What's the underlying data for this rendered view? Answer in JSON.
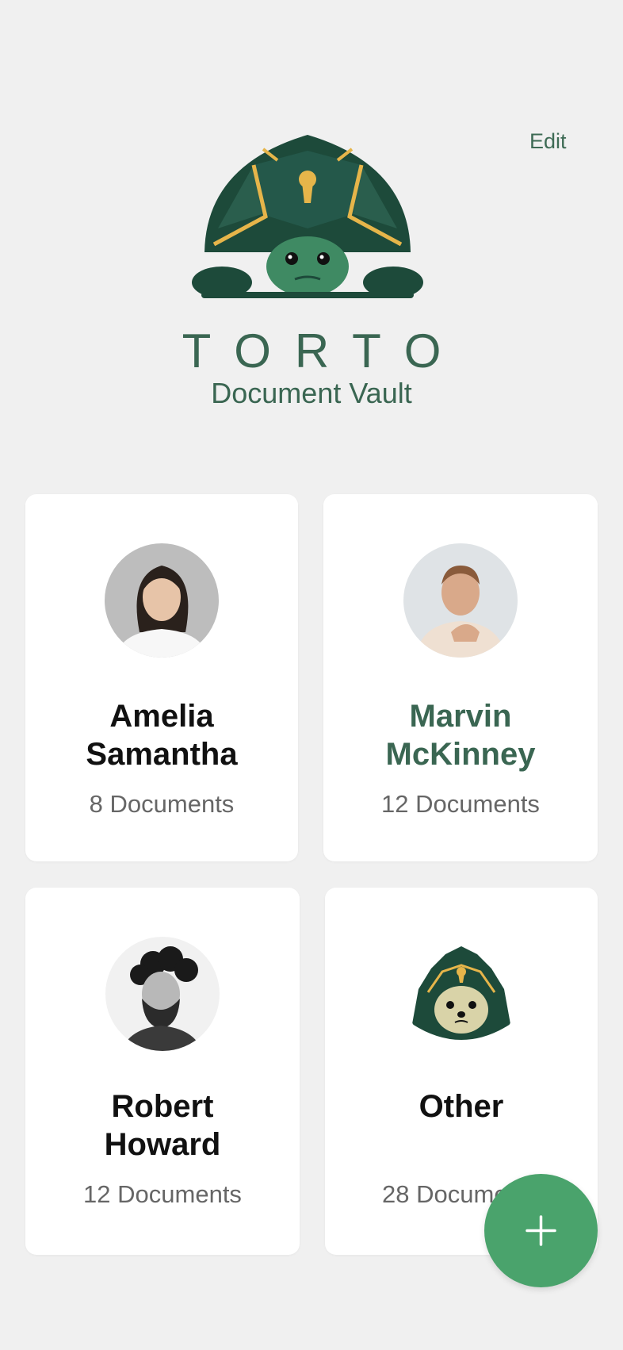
{
  "header": {
    "edit_label": "Edit",
    "brand_title": "TORTO",
    "brand_subtitle": "Document Vault"
  },
  "profiles": [
    {
      "name": "Amelia Samantha",
      "name_line1": "Amelia",
      "name_line2": "Samantha",
      "count": "8 Documents"
    },
    {
      "name": "Marvin McKinney",
      "name_line1": "Marvin",
      "name_line2": "McKinney",
      "count": "12 Documents"
    },
    {
      "name": "Robert Howard",
      "name_line1": "Robert",
      "name_line2": "Howard",
      "count": "12 Documents"
    },
    {
      "name": "Other",
      "name_line1": "Other",
      "name_line2": "",
      "count": "28 Documents"
    }
  ],
  "fab": {
    "icon": "plus-icon"
  },
  "colors": {
    "brand_green": "#3a6652",
    "fab_green": "#4aa36c",
    "background": "#f0f0f0",
    "gold": "#e6b54a"
  }
}
